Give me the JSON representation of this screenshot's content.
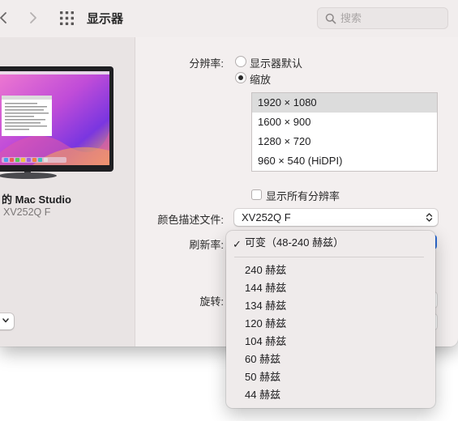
{
  "toolbar": {
    "title": "显示器",
    "search_placeholder": "搜索",
    "icons": [
      "back-chevron-icon",
      "forward-chevron-icon",
      "grid-icon",
      "search-icon"
    ]
  },
  "sidebar": {
    "display_name": "的 Mac Studio",
    "display_model": "XV252Q F"
  },
  "settings": {
    "resolution_label": "分辨率:",
    "resolution_options": [
      "显示器默认",
      "缩放"
    ],
    "resolution_selected": "缩放",
    "resolutions": [
      "1920 × 1080",
      "1600 × 900",
      "1280 × 720",
      "960 × 540 (HiDPI)"
    ],
    "resolution_selected_item": "1920 × 1080",
    "show_all_label": "显示所有分辨率",
    "color_profile_label": "颜色描述文件:",
    "color_profile_value": "XV252Q F",
    "refresh_label": "刷新率:",
    "rotation_label": "旋转:"
  },
  "refresh_menu": {
    "checkmark": "✓",
    "selected": "可变（48-240 赫兹）",
    "items": [
      "240 赫兹",
      "144 赫兹",
      "134 赫兹",
      "120 赫兹",
      "104 赫兹",
      "60 赫兹",
      "50 赫兹",
      "44 赫兹"
    ]
  },
  "colors": {
    "window_bg": "#f3efef",
    "sidebar_bg": "#e9e4e4",
    "accent": "#2f6fdc"
  }
}
